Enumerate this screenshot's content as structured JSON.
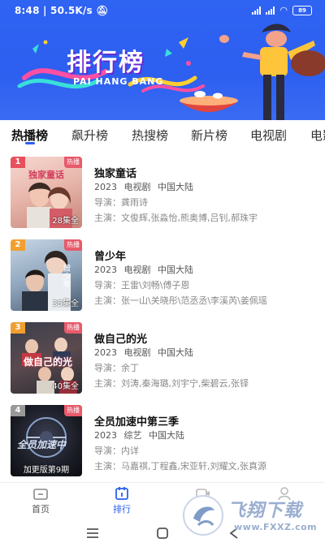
{
  "status_bar": {
    "time": "8:48",
    "speed": "50.5K/s",
    "battery": "89"
  },
  "banner": {
    "title": "排行榜",
    "subtitle": "PAI HANG BANG"
  },
  "tabs": [
    {
      "label": "热播榜",
      "active": true
    },
    {
      "label": "飙升榜",
      "active": false
    },
    {
      "label": "热搜榜",
      "active": false
    },
    {
      "label": "新片榜",
      "active": false
    },
    {
      "label": "电视剧",
      "active": false
    },
    {
      "label": "电影",
      "active": false
    }
  ],
  "items": [
    {
      "rank": "1",
      "badge": "热播",
      "poster_text": "独家童话",
      "episodes": "28集全",
      "title": "独家童话",
      "year": "2023",
      "type": "电视剧",
      "region": "中国大陆",
      "director_label": "导演：",
      "director": "龚雨诗",
      "cast_label": "主演：",
      "cast": "文俊辉,张淼怡,熊奥博,吕钊,郝珠宇",
      "rank_color": "#e8505b"
    },
    {
      "rank": "2",
      "badge": "热播",
      "poster_text": "曾少年",
      "episodes": "35集全",
      "title": "曾少年",
      "year": "2023",
      "type": "电视剧",
      "region": "中国大陆",
      "director_label": "导演：",
      "director": "王雷\\刘畅\\傅子恩",
      "cast_label": "主演：",
      "cast": "张一山\\关晓彤\\范丞丞\\李溪芮\\姜佩瑶",
      "rank_color": "#f0a030"
    },
    {
      "rank": "3",
      "badge": "热播",
      "poster_text": "做自己的光",
      "episodes": "40集全",
      "title": "做自己的光",
      "year": "2023",
      "type": "电视剧",
      "region": "中国大陆",
      "director_label": "导演：",
      "director": "余丁",
      "cast_label": "主演：",
      "cast": "刘涛,秦海璐,刘宇宁,柴碧云,张铎",
      "rank_color": "#f0a030"
    },
    {
      "rank": "4",
      "badge": "热播",
      "poster_text": "全员加速中",
      "episodes": "加更版第9期",
      "title": "全员加速中第三季",
      "year": "2023",
      "type": "综艺",
      "region": "中国大陆",
      "director_label": "导演：",
      "director": "内详",
      "cast_label": "主演：",
      "cast": "马嘉祺,丁程鑫,宋亚轩,刘耀文,张真源",
      "rank_color": "#999999"
    }
  ],
  "bottom_nav": [
    {
      "label": "首页",
      "active": false
    },
    {
      "label": "排行",
      "active": true
    }
  ],
  "watermark": {
    "text": "飞翔下载",
    "url": "www.FXXZ.com"
  },
  "colors": {
    "accent": "#2d5ff0",
    "hot_badge": "#e85a6b"
  }
}
